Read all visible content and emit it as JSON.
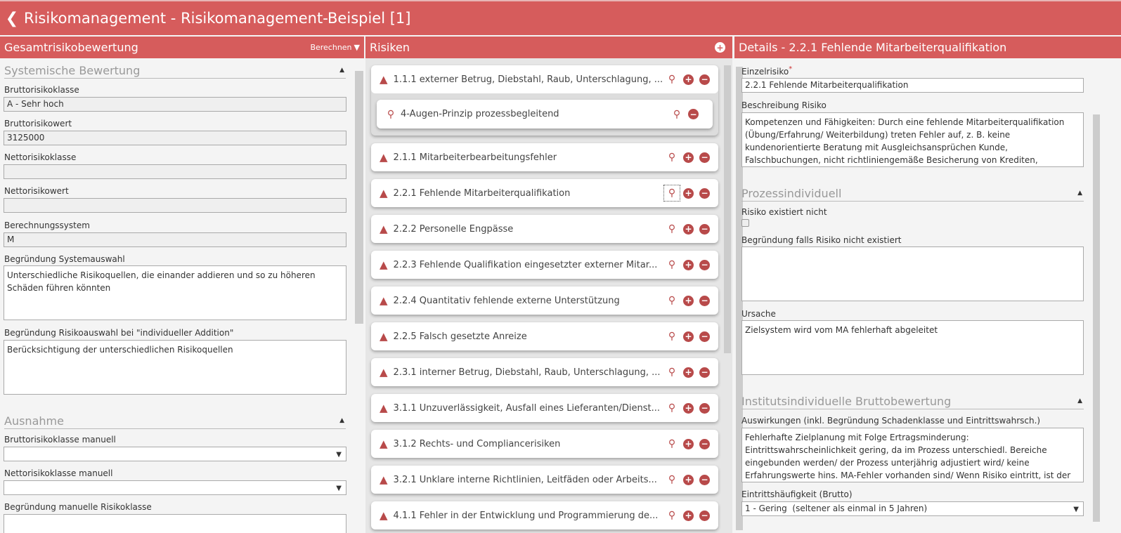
{
  "header": {
    "title": "Risikomanagement - Risikomanagement-Beispiel [1]"
  },
  "left": {
    "title": "Gesamtrisikobewertung",
    "action": "Berechnen",
    "section1": "Systemische Bewertung",
    "fields": [
      {
        "label": "Bruttorisikoklasse",
        "value": "A - Sehr hoch"
      },
      {
        "label": "Bruttorisikowert",
        "value": "3125000"
      },
      {
        "label": "Nettorisikoklasse",
        "value": ""
      },
      {
        "label": "Nettorisikowert",
        "value": ""
      },
      {
        "label": "Berechnungssystem",
        "value": "M"
      }
    ],
    "begr_system_label": "Begründung Systemauswahl",
    "begr_system_value": "Unterschiedliche Risikoquellen, die einander addieren und so zu höheren Schäden führen könnten",
    "begr_risiko_label": "Begründung Risikoauswahl bei \"individueller Addition\"",
    "begr_risiko_value": "Berücksichtigung der unterschiedlichen Risikoquellen",
    "section2": "Ausnahme",
    "brutto_manuell_label": "Bruttorisikoklasse manuell",
    "brutto_manuell_value": "",
    "netto_manuell_label": "Nettorisikoklasse manuell",
    "netto_manuell_value": "",
    "begr_manuell_label": "Begründung manuelle Risikoklasse"
  },
  "middle": {
    "title": "Risiken",
    "first": "1.1.1 externer Betrug, Diebstahl, Raub, Unterschlagung, ...",
    "measure": "4-Augen-Prinzip prozessbegleitend",
    "items": [
      "2.1.1 Mitarbeiterbearbeitungsfehler",
      "2.2.1 Fehlende Mitarbeiterqualifikation",
      "2.2.2 Personelle Engpässe",
      "2.2.3 Fehlende Qualifikation eingesetzter externer Mitar...",
      "2.2.4 Quantitativ fehlende externe Unterstützung",
      "2.2.5 Falsch gesetzte Anreize",
      "2.3.1 interner Betrug, Diebstahl, Raub, Unterschlagung, ...",
      "3.1.1 Unzuverlässigkeit, Ausfall eines Lieferanten/Dienst...",
      "3.1.2 Rechts- und Compliancerisiken",
      "3.2.1 Unklare interne Richtlinien, Leitfäden oder Arbeits...",
      "4.1.1 Fehler in der Entwicklung und Programmierung de..."
    ]
  },
  "right": {
    "title": "Details - 2.2.1 Fehlende Mitarbeiterqualifikation",
    "einzel_label": "Einzelrisiko",
    "required": "*",
    "einzel_value": "2.2.1 Fehlende Mitarbeiterqualifikation",
    "beschr_label": "Beschreibung Risiko",
    "beschr_value": "Kompetenzen und Fähigkeiten: Durch eine fehlende Mitarbeiterqualifikation (Übung/Erfahrung/ Weiterbildung) treten Fehler auf, z. B. keine kundenorientierte Beratung mit Ausgleichsansprüchen Kunde, Falschbuchungen, nicht richtliniengemäße Besicherung von Krediten, falsche",
    "section1": "Prozessindividuell",
    "existiert_label": "Risiko existiert nicht",
    "begr_label": "Begründung falls Risiko nicht existiert",
    "begr_value": "",
    "ursache_label": "Ursache",
    "ursache_value": "Zielsystem wird vom MA fehlerhaft abgeleitet",
    "section2": "Institutsindividuelle Bruttobewertung",
    "ausw_label": "Auswirkungen (inkl. Begründung Schadenklasse und Eintrittswahrsch.)",
    "ausw_value": "Fehlerhafte Zielplanung mit Folge Ertragsminderung: Eintrittswahrscheinlichkeit gering, da im Prozess unterschiedl. Bereiche eingebunden werden/ der Prozess unterjährig adjustiert wird/ keine Erfahrungswerte hins. MA-Fehler vorhanden sind/ Wenn Risiko eintritt, ist der finanzielle sehr hohe Schaden schnell",
    "haeuf_label": "Eintrittshäufigkeit (Brutto)",
    "haeuf_value": "1 - Gering  (seltener als einmal in 5 Jahren)"
  }
}
